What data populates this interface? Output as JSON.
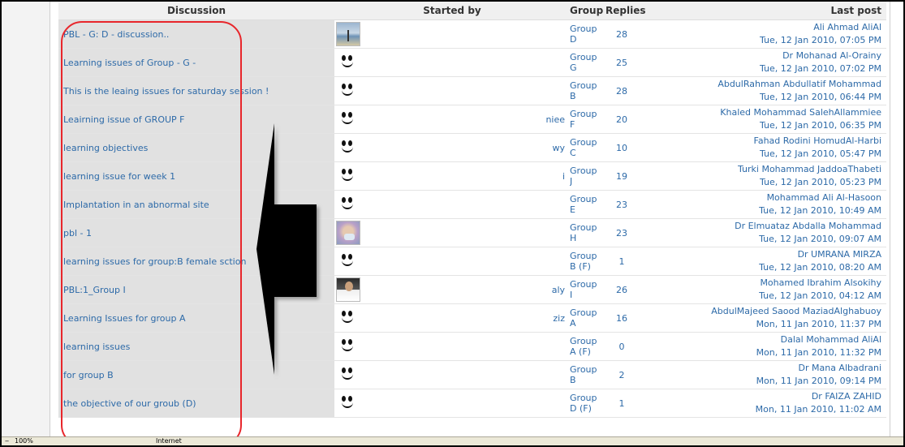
{
  "table": {
    "headers": {
      "discussion": "Discussion",
      "started_by": "Started by",
      "group": "Group",
      "replies": "Replies",
      "last_post": "Last post"
    },
    "rows": [
      {
        "topic": "PBL - G: D - discussion..",
        "avatar": "photo-beach",
        "starter": "",
        "group": "Group D",
        "replies": "28",
        "last_by": "Ali Ahmad AliAl",
        "last_date": "Tue, 12 Jan 2010, 07:05 PM"
      },
      {
        "topic": "Learning issues of Group - G -",
        "avatar": "smiley",
        "starter": "",
        "group": "Group G",
        "replies": "25",
        "last_by": "Dr Mohanad Al-Orainy",
        "last_date": "Tue, 12 Jan 2010, 07:02 PM"
      },
      {
        "topic": "This is the leaing issues for saturday session !",
        "avatar": "smiley",
        "starter": "",
        "group": "Group B",
        "replies": "28",
        "last_by": "AbdulRahman Abdullatif Mohammad",
        "last_date": "Tue, 12 Jan 2010, 06:44 PM"
      },
      {
        "topic": "Leairning issue of GROUP F",
        "avatar": "smiley",
        "starter": "niee",
        "group": "Group F",
        "replies": "20",
        "last_by": "Khaled Mohammad SalehAllammiee",
        "last_date": "Tue, 12 Jan 2010, 06:35 PM"
      },
      {
        "topic": "learning objectives",
        "avatar": "smiley",
        "starter": "wy",
        "group": "Group C",
        "replies": "10",
        "last_by": "Fahad Rodini HomudAl-Harbi",
        "last_date": "Tue, 12 Jan 2010, 05:47 PM"
      },
      {
        "topic": "learning issue for week 1",
        "avatar": "smiley",
        "starter": "i",
        "group": "Group J",
        "replies": "19",
        "last_by": "Turki Mohammad JaddoaThabeti",
        "last_date": "Tue, 12 Jan 2010, 05:23 PM"
      },
      {
        "topic": "Implantation in an abnormal site",
        "avatar": "smiley",
        "starter": "",
        "group": "Group E",
        "replies": "23",
        "last_by": "Mohammad Ali Al-Hasoon",
        "last_date": "Tue, 12 Jan 2010, 10:49 AM"
      },
      {
        "topic": "pbl - 1",
        "avatar": "photo-mask",
        "starter": "",
        "group": "Group H",
        "replies": "23",
        "last_by": "Dr Elmuataz Abdalla Mohammad",
        "last_date": "Tue, 12 Jan 2010, 09:07 AM"
      },
      {
        "topic": "learning issues for group:B female sction",
        "avatar": "smiley",
        "starter": "",
        "group": "Group B (F)",
        "replies": "1",
        "last_by": "Dr UMRANA MIRZA",
        "last_date": "Tue, 12 Jan 2010, 08:20 AM"
      },
      {
        "topic": "PBL:1_Group I",
        "avatar": "photo-man",
        "starter": "aly",
        "group": "Group I",
        "replies": "26",
        "last_by": "Mohamed Ibrahim Alsokihy",
        "last_date": "Tue, 12 Jan 2010, 04:12 AM"
      },
      {
        "topic": "Learning Issues for group A",
        "avatar": "smiley",
        "starter": "ziz",
        "group": "Group A",
        "replies": "16",
        "last_by": "AbdulMajeed Saood MaziadAlghabuoy",
        "last_date": "Mon, 11 Jan 2010, 11:37 PM"
      },
      {
        "topic": "learning issues",
        "avatar": "smiley",
        "starter": "",
        "group": "Group A (F)",
        "replies": "0",
        "last_by": "Dalal Mohammad AliAl",
        "last_date": "Mon, 11 Jan 2010, 11:32 PM"
      },
      {
        "topic": "for group B",
        "avatar": "smiley",
        "starter": "",
        "group": "Group B",
        "replies": "2",
        "last_by": "Dr Mana Albadrani",
        "last_date": "Mon, 11 Jan 2010, 09:14 PM"
      },
      {
        "topic": "the objective of our groub (D)",
        "avatar": "smiley",
        "starter": "",
        "group": "Group D (F)",
        "replies": "1",
        "last_by": "Dr FAIZA ZAHID",
        "last_date": "Mon, 11 Jan 2010, 11:02 AM"
      }
    ]
  },
  "statusbar": {
    "zoom": "100%",
    "zone": "Internet"
  },
  "colors": {
    "link": "#2d6aa8",
    "highlight_border": "#e8262b",
    "topic_cell_bg": "#e1e1e1"
  }
}
